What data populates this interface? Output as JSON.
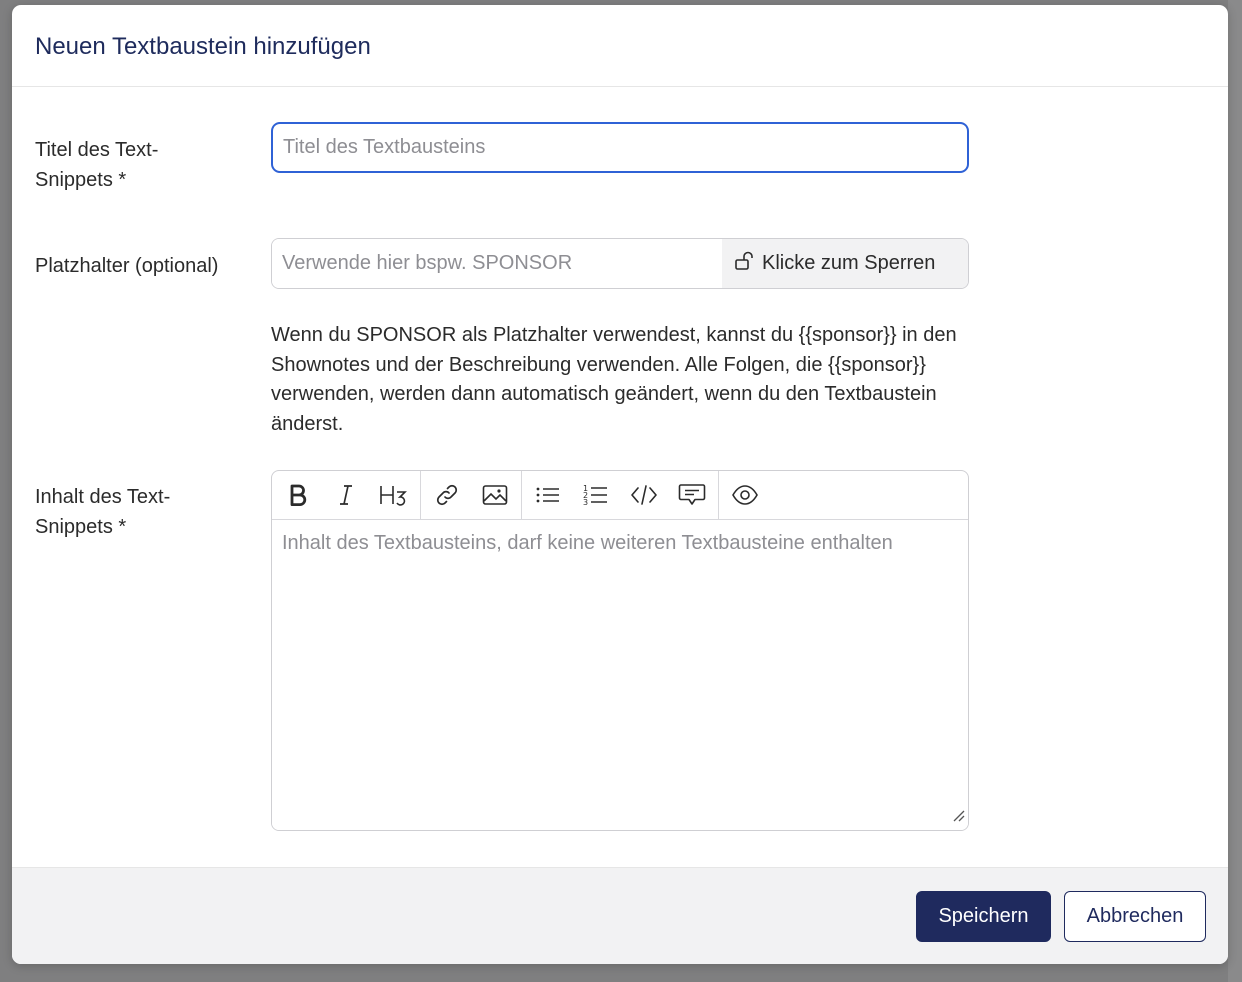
{
  "modal": {
    "title": "Neuen Textbaustein hinzufügen"
  },
  "form": {
    "title_label": "Titel des Text-Snippets *",
    "title_placeholder": "Titel des Textbausteins",
    "title_value": "",
    "placeholder_label": "Platzhalter (optional)",
    "placeholder_placeholder": "Verwende hier bspw. SPONSOR",
    "placeholder_value": "",
    "lock_button_label": "Klicke zum Sperren",
    "help_text": "Wenn du SPONSOR als Platzhalter verwendest, kannst du {{sponsor}} in den Shownotes und der Beschreibung verwenden. Alle Folgen, die {{sponsor}} verwenden, werden dann automatisch geändert, wenn du den Textbaustein änderst.",
    "content_label": "Inhalt des Text-Snippets *",
    "content_placeholder": "Inhalt des Textbausteins, darf keine weiteren Textbausteine enthalten",
    "content_value": ""
  },
  "toolbar": {
    "buttons": [
      "bold-icon",
      "italic-icon",
      "heading-icon",
      "link-icon",
      "image-icon",
      "unordered-list-icon",
      "ordered-list-icon",
      "code-icon",
      "quote-icon",
      "preview-icon"
    ]
  },
  "footer": {
    "save_label": "Speichern",
    "cancel_label": "Abbrechen"
  },
  "colors": {
    "primary": "#1f2a5e",
    "title": "#1e2b5c",
    "focus_border": "#2f62d6",
    "footer_bg": "#f2f2f3",
    "overlay": "#7f7f80"
  }
}
